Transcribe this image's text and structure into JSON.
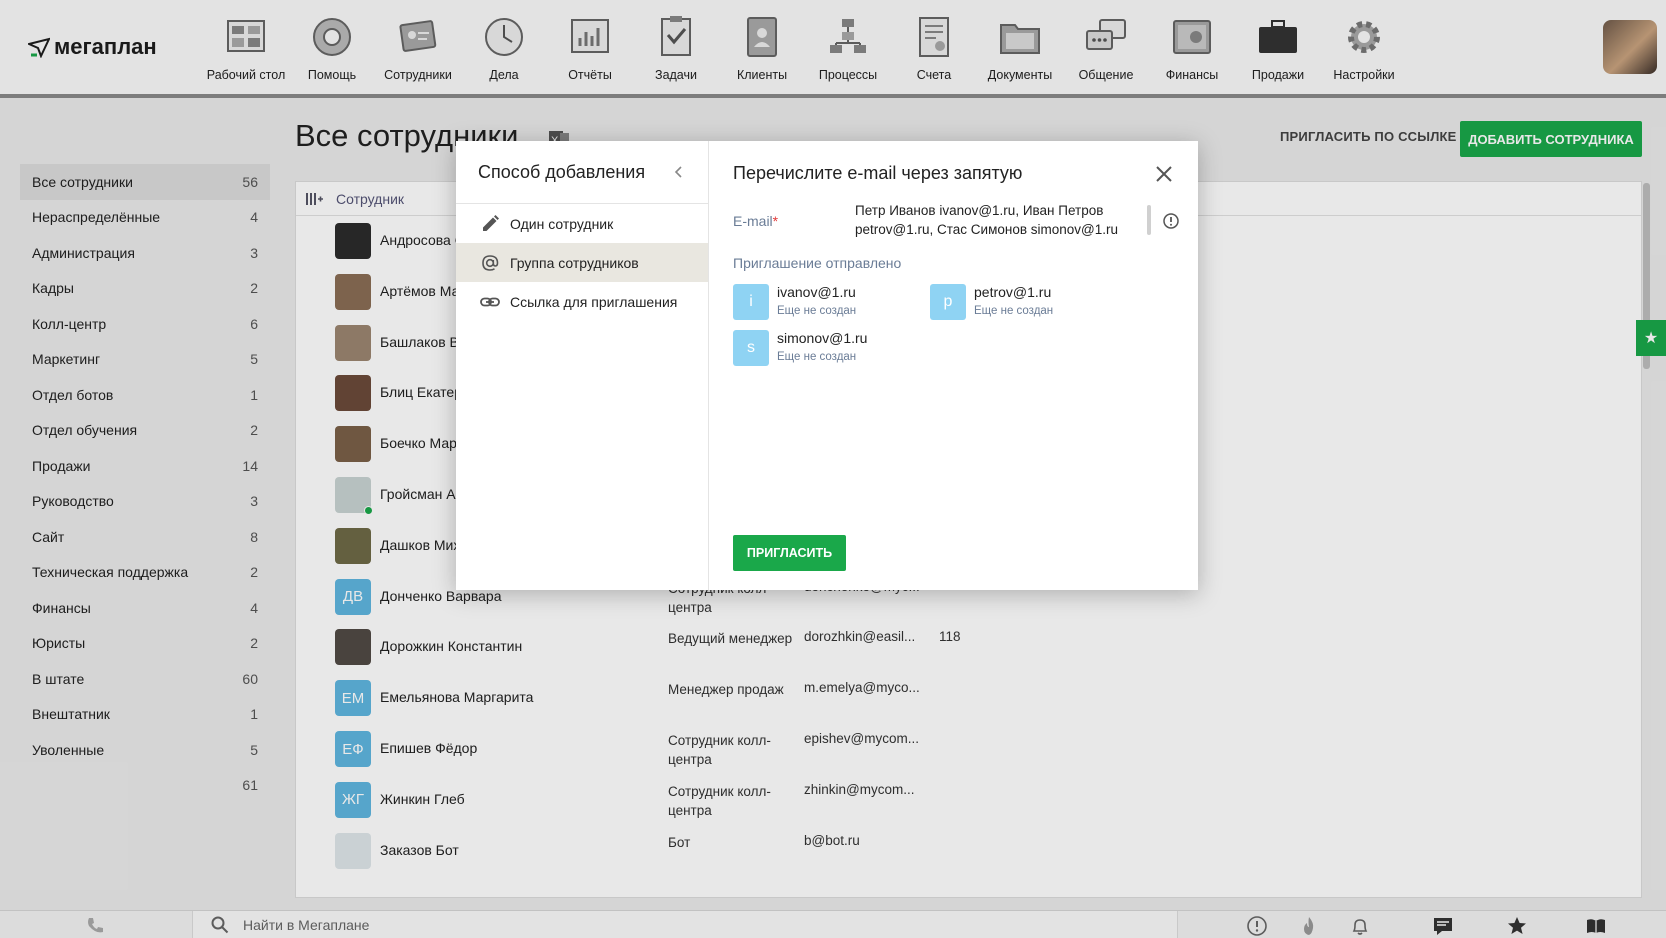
{
  "app": {
    "logo_text": "мегаплан"
  },
  "nav": [
    {
      "label": "Рабочий стол",
      "icon": "desktop-icon"
    },
    {
      "label": "Помощь",
      "icon": "lifebuoy-icon"
    },
    {
      "label": "Сотрудники",
      "icon": "employees-icon"
    },
    {
      "label": "Дела",
      "icon": "clock-icon"
    },
    {
      "label": "Отчёты",
      "icon": "reports-icon"
    },
    {
      "label": "Задачи",
      "icon": "tasks-icon"
    },
    {
      "label": "Клиенты",
      "icon": "clients-icon"
    },
    {
      "label": "Процессы",
      "icon": "processes-icon"
    },
    {
      "label": "Счета",
      "icon": "invoices-icon"
    },
    {
      "label": "Документы",
      "icon": "documents-icon"
    },
    {
      "label": "Общение",
      "icon": "chat-icon"
    },
    {
      "label": "Финансы",
      "icon": "safe-icon"
    },
    {
      "label": "Продажи",
      "icon": "briefcase-icon"
    },
    {
      "label": "Настройки",
      "icon": "gear-icon"
    }
  ],
  "page": {
    "title": "Все сотрудники",
    "invite_link_label": "ПРИГЛАСИТЬ ПО ССЫЛКЕ",
    "add_employee_label": "ДОБАВИТЬ СОТРУДНИКА"
  },
  "sidebar": {
    "items": [
      {
        "label": "Все сотрудники",
        "count": "56"
      },
      {
        "label": "Нераспределённые",
        "count": "4"
      },
      {
        "label": "Администрация",
        "count": "3"
      },
      {
        "label": "Кадры",
        "count": "2"
      },
      {
        "label": "Колл-центр",
        "count": "6"
      },
      {
        "label": "Маркетинг",
        "count": "5"
      },
      {
        "label": "Отдел ботов",
        "count": "1"
      },
      {
        "label": "Отдел обучения",
        "count": "2"
      },
      {
        "label": "Продажи",
        "count": "14"
      },
      {
        "label": "Руководство",
        "count": "3"
      },
      {
        "label": "Сайт",
        "count": "8"
      },
      {
        "label": "Техническая поддержка",
        "count": "2"
      },
      {
        "label": "Финансы",
        "count": "4"
      },
      {
        "label": "Юристы",
        "count": "2"
      },
      {
        "label": "В штате",
        "count": "60"
      },
      {
        "label": "Внештатник",
        "count": "1"
      },
      {
        "label": "Уволенные",
        "count": "5"
      },
      {
        "label": "",
        "count": "61"
      }
    ]
  },
  "table": {
    "header_employee": "Сотрудник",
    "rows": [
      {
        "name": "Андросова С",
        "initials": "",
        "position": "",
        "email": "",
        "phone": ""
      },
      {
        "name": "Артёмов Ма",
        "initials": "",
        "position": "",
        "email": "",
        "phone": ""
      },
      {
        "name": "Башлаков В",
        "initials": "",
        "position": "",
        "email": "",
        "phone": ""
      },
      {
        "name": "Блиц Екатер",
        "initials": "",
        "position": "",
        "email": "",
        "phone": ""
      },
      {
        "name": "Боечко Мар",
        "initials": "",
        "position": "",
        "email": "",
        "phone": ""
      },
      {
        "name": "Гройсман Ан",
        "initials": "",
        "position": "",
        "email": "",
        "phone": ""
      },
      {
        "name": "Дашков Мих",
        "initials": "",
        "position": "",
        "email": "",
        "phone": ""
      },
      {
        "name": "Донченко Варвара",
        "initials": "ДВ",
        "position": "Сотрудник колл-центра",
        "email": "donchenko@myc...",
        "phone": ""
      },
      {
        "name": "Дорожкин Константин",
        "initials": "",
        "position": "Ведущий менеджер",
        "email": "dorozhkin@easil...",
        "phone": "118"
      },
      {
        "name": "Емельянова Маргарита",
        "initials": "ЕМ",
        "position": "Менеджер продаж",
        "email": "m.emelya@myco...",
        "phone": ""
      },
      {
        "name": "Епишев Фёдор",
        "initials": "ЕФ",
        "position": "Сотрудник колл-центра",
        "email": "epishev@mycom...",
        "phone": ""
      },
      {
        "name": "Жинкин Глеб",
        "initials": "ЖГ",
        "position": "Сотрудник колл-центра",
        "email": "zhinkin@mycom...",
        "phone": ""
      },
      {
        "name": "Заказов Бот",
        "initials": "",
        "position": "Бот",
        "email": "b@bot.ru",
        "phone": ""
      }
    ]
  },
  "modal": {
    "left_title": "Способ добавления",
    "options": [
      {
        "label": "Один сотрудник",
        "icon": "pencil-icon"
      },
      {
        "label": "Группа сотрудников",
        "icon": "at-sign-icon"
      },
      {
        "label": "Ссылка для приглашения",
        "icon": "link-icon"
      }
    ],
    "right_title": "Перечислите e-mail через запятую",
    "email_label": "E-mail",
    "required_mark": "*",
    "email_value": "Петр Иванов ivanov@1.ru, Иван Петров petrov@1.ru, Стас Симонов simonov@1.ru",
    "sent_label": "Приглашение отправлено",
    "invites": [
      {
        "letter": "i",
        "email": "ivanov@1.ru",
        "status": "Еще не создан"
      },
      {
        "letter": "p",
        "email": "petrov@1.ru",
        "status": "Еще не создан"
      },
      {
        "letter": "s",
        "email": "simonov@1.ru",
        "status": "Еще не создан"
      }
    ],
    "invite_button": "ПРИГЛАСИТЬ"
  },
  "bottom": {
    "search_placeholder": "Найти в Мегаплане"
  },
  "colors": {
    "accent": "#1aa84a",
    "invite_avatar": "#8fd3f3",
    "initials_avatar": "#5fb6e0"
  }
}
